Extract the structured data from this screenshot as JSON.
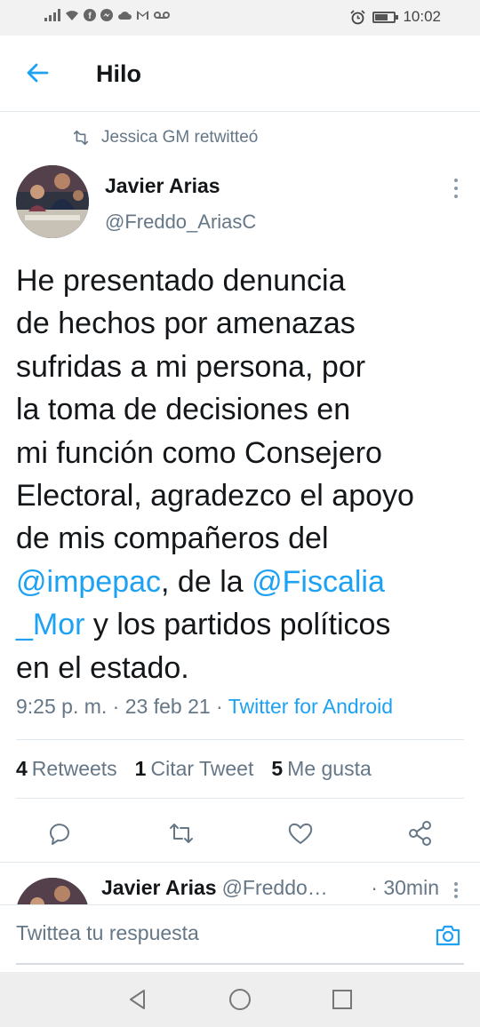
{
  "status_bar": {
    "time": "10:02"
  },
  "header": {
    "title": "Hilo"
  },
  "retweet_context": {
    "label": "Jessica GM retwitteó"
  },
  "tweet": {
    "author_name": "Javier Arias",
    "author_handle": "@Freddo_AriasC",
    "text_lines": [
      [
        "He presentado denuncia"
      ],
      [
        "de hechos por amenazas"
      ],
      [
        "sufridas a mi persona, por"
      ],
      [
        "la toma de decisiones en"
      ],
      [
        "mi función como Consejero"
      ],
      [
        "Electoral, agradezco el apoyo"
      ],
      [
        "de mis compañeros del"
      ],
      [
        "@impepac",
        ", de la ",
        "@Fiscalia"
      ],
      [
        "_Mor",
        " y los partidos políticos"
      ],
      [
        "en el estado."
      ]
    ],
    "mention_1": "@impepac",
    "mention_2a": "@Fiscalia",
    "mention_2b": "_Mor",
    "time": "9:25 p. m.",
    "date": "23 feb 21",
    "source": "Twitter for Android",
    "separator": " · "
  },
  "stats": {
    "retweets_count": "4",
    "retweets_label": "Retweets",
    "quotes_count": "1",
    "quotes_label": "Citar Tweet",
    "likes_count": "5",
    "likes_label": "Me gusta"
  },
  "actions": [
    "reply-icon",
    "retweet-icon",
    "like-icon",
    "share-icon"
  ],
  "reply_preview": {
    "author_name": "Javier Arias",
    "author_handle": "@Freddo…",
    "time": "· 30min"
  },
  "compose": {
    "placeholder": "Twittea tu respuesta"
  },
  "colors": {
    "accent": "#1da1f2",
    "secondary_text": "#657786",
    "primary_text": "#14171a",
    "divider": "#e1e8ed"
  }
}
